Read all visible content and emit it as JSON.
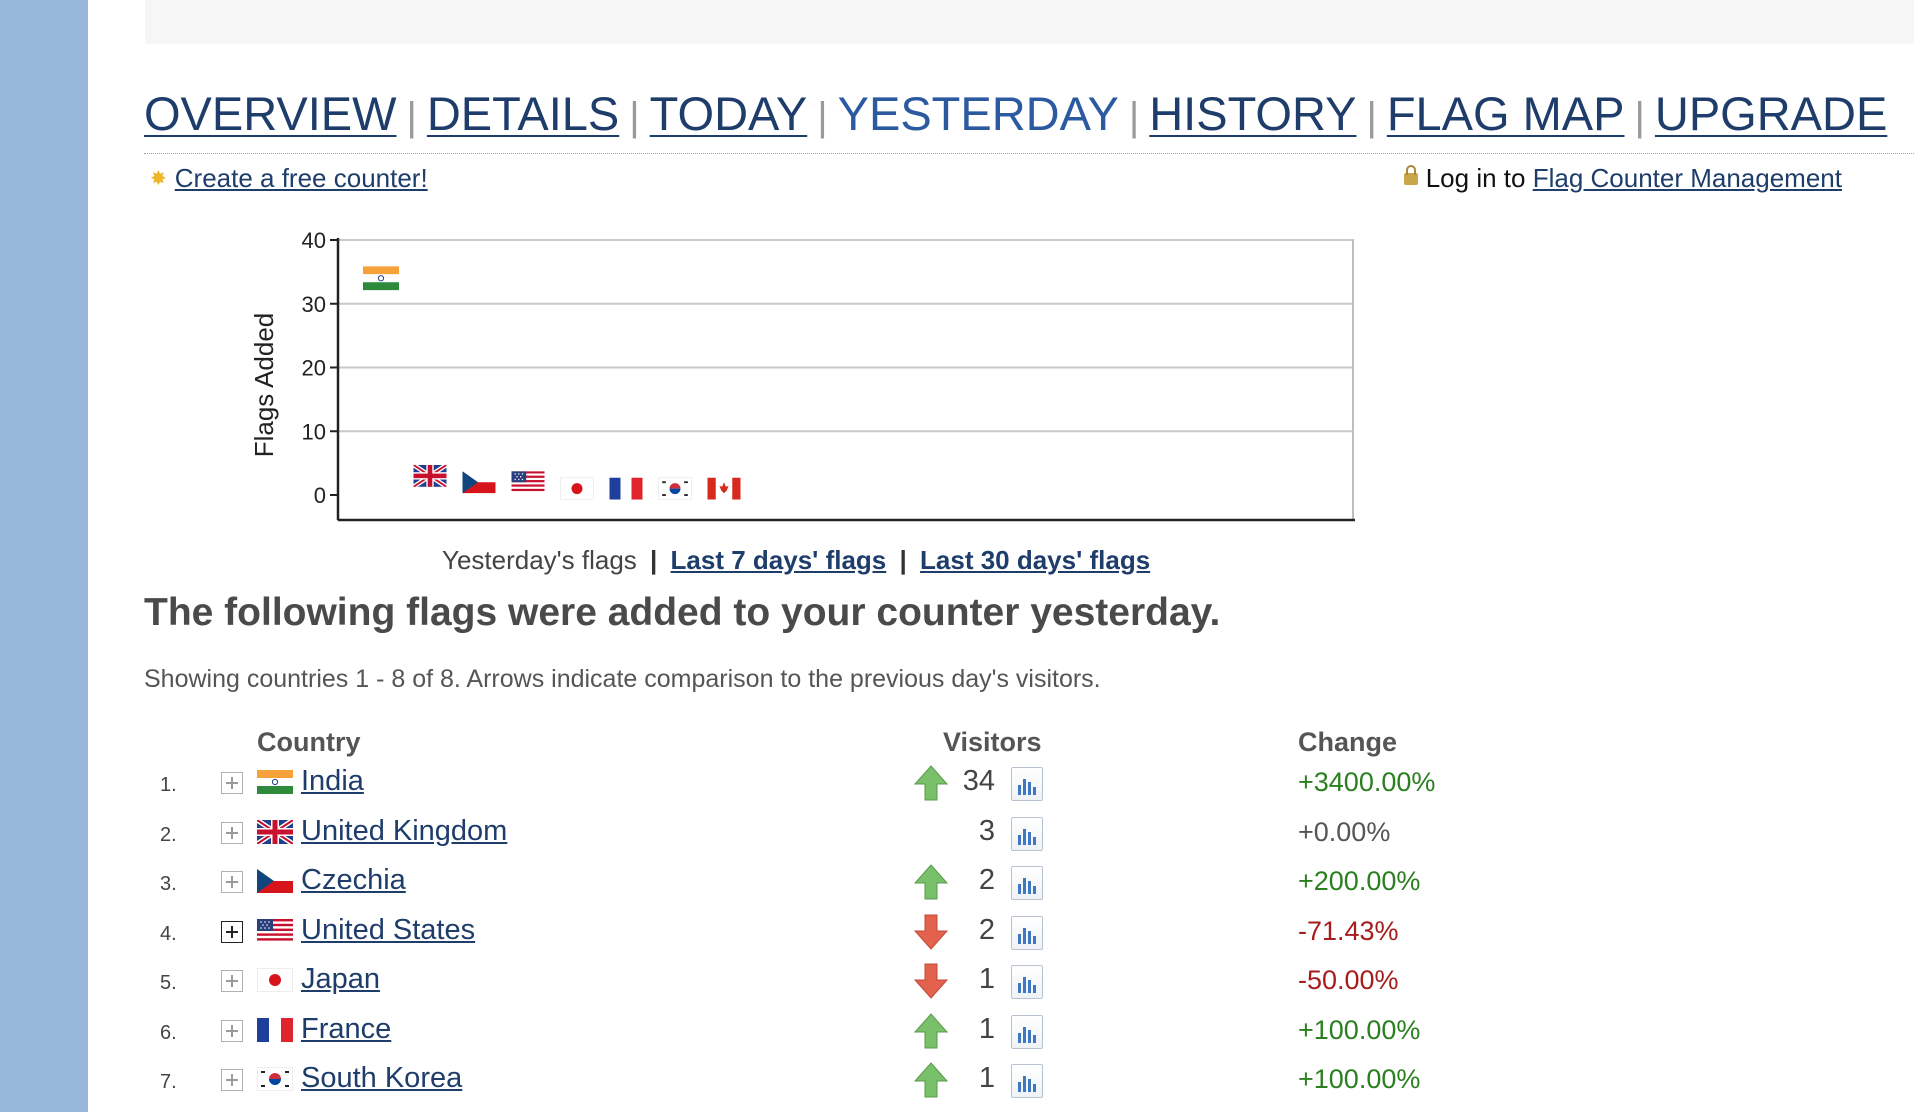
{
  "nav": {
    "items": [
      {
        "label": "OVERVIEW",
        "current": false
      },
      {
        "label": "DETAILS",
        "current": false
      },
      {
        "label": "TODAY",
        "current": false
      },
      {
        "label": "YESTERDAY",
        "current": true
      },
      {
        "label": "HISTORY",
        "current": false
      },
      {
        "label": "FLAG MAP",
        "current": false
      },
      {
        "label": "UPGRADE",
        "current": false
      }
    ]
  },
  "create_counter": {
    "label": "Create a free counter!"
  },
  "login": {
    "prefix": "Log in to",
    "link": "Flag Counter Management"
  },
  "chart_data": {
    "type": "scatter",
    "title": "",
    "xlabel": "",
    "ylabel": "Flags Added",
    "ylim": [
      0,
      40
    ],
    "yticks": [
      "0",
      "10",
      "20",
      "30",
      "40"
    ],
    "grid": true,
    "categories": [
      "India",
      "United Kingdom",
      "Czechia",
      "United States",
      "Japan",
      "France",
      "South Korea",
      "Canada"
    ],
    "values": [
      34,
      3,
      2,
      2,
      1,
      1,
      1,
      1
    ],
    "markers": [
      "flag-in",
      "flag-gb",
      "flag-cz",
      "flag-us",
      "flag-jp",
      "flag-fr",
      "flag-kr",
      "flag-ca"
    ]
  },
  "chart_links": {
    "current": "Yesterday's flags",
    "separator": "|",
    "last7": "Last 7 days' flags",
    "last30": "Last 30 days' flags"
  },
  "headline": "The following flags were added to your counter yesterday.",
  "subtext": "Showing countries 1 - 8 of 8. Arrows indicate comparison to the previous day's visitors.",
  "table": {
    "headers": {
      "country": "Country",
      "visitors": "Visitors",
      "change": "Change"
    },
    "rows": [
      {
        "rank": "1.",
        "country": "India",
        "flag": "flag-in",
        "visitors": "34",
        "trend": "up",
        "change": "+3400.00%",
        "expanded": false
      },
      {
        "rank": "2.",
        "country": "United Kingdom",
        "flag": "flag-gb",
        "visitors": "3",
        "trend": "none",
        "change": "+0.00%",
        "expanded": false
      },
      {
        "rank": "3.",
        "country": "Czechia",
        "flag": "flag-cz",
        "visitors": "2",
        "trend": "up",
        "change": "+200.00%",
        "expanded": false
      },
      {
        "rank": "4.",
        "country": "United States",
        "flag": "flag-us",
        "visitors": "2",
        "trend": "down",
        "change": "-71.43%",
        "expanded": true
      },
      {
        "rank": "5.",
        "country": "Japan",
        "flag": "flag-jp",
        "visitors": "1",
        "trend": "down",
        "change": "-50.00%",
        "expanded": false
      },
      {
        "rank": "6.",
        "country": "France",
        "flag": "flag-fr",
        "visitors": "1",
        "trend": "up",
        "change": "+100.00%",
        "expanded": false
      },
      {
        "rank": "7.",
        "country": "South Korea",
        "flag": "flag-kr",
        "visitors": "1",
        "trend": "up",
        "change": "+100.00%",
        "expanded": false
      }
    ]
  },
  "colors": {
    "sidebar": "#96b6da",
    "link": "#1f3d6b",
    "current_nav": "#2c5aa0",
    "positive": "#2a7f1f",
    "negative": "#a61d1d",
    "arrow_up": "#78c06a",
    "arrow_down": "#e2624d"
  }
}
